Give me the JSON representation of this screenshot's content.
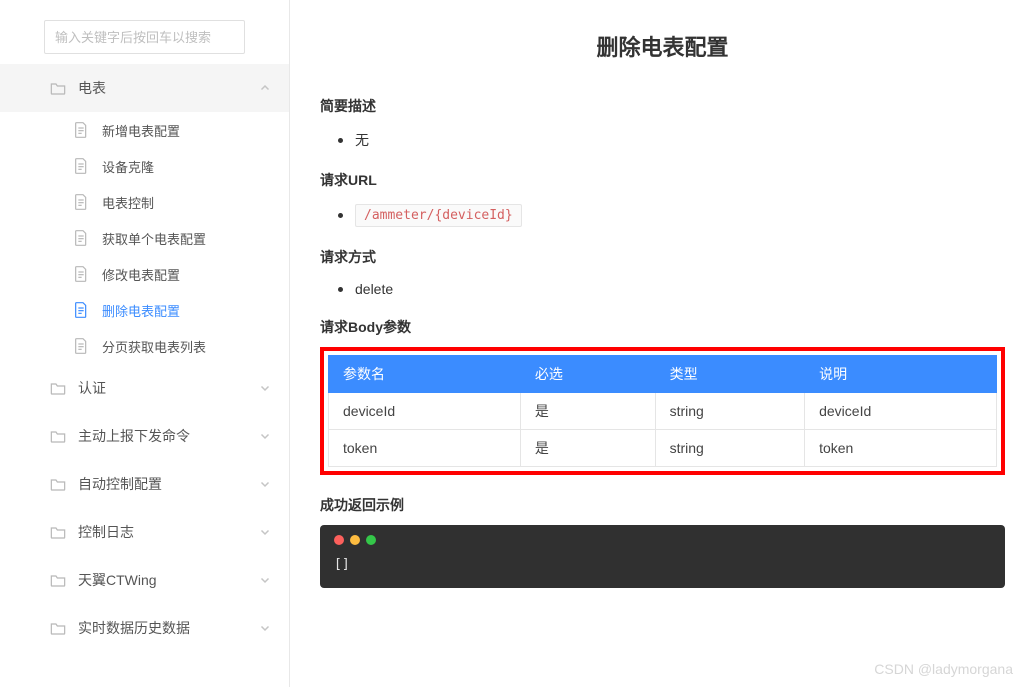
{
  "search": {
    "placeholder": "输入关键字后按回车以搜索"
  },
  "sidebar": {
    "groups": [
      {
        "label": "电表",
        "expanded": true,
        "items": [
          {
            "label": "新增电表配置",
            "active": false
          },
          {
            "label": "设备克隆",
            "active": false
          },
          {
            "label": "电表控制",
            "active": false
          },
          {
            "label": "获取单个电表配置",
            "active": false
          },
          {
            "label": "修改电表配置",
            "active": false
          },
          {
            "label": "删除电表配置",
            "active": true
          },
          {
            "label": "分页获取电表列表",
            "active": false
          }
        ]
      },
      {
        "label": "认证",
        "expanded": false,
        "items": []
      },
      {
        "label": "主动上报下发命令",
        "expanded": false,
        "items": []
      },
      {
        "label": "自动控制配置",
        "expanded": false,
        "items": []
      },
      {
        "label": "控制日志",
        "expanded": false,
        "items": []
      },
      {
        "label": "天翼CTWing",
        "expanded": false,
        "items": []
      },
      {
        "label": "实时数据历史数据",
        "expanded": false,
        "items": []
      }
    ]
  },
  "page": {
    "title": "删除电表配置",
    "sections": {
      "brief": {
        "title": "简要描述",
        "value": "无"
      },
      "url": {
        "title": "请求URL",
        "value": "/ammeter/{deviceId}"
      },
      "method": {
        "title": "请求方式",
        "value": "delete"
      },
      "body_params": {
        "title": "请求Body参数",
        "headers": [
          "参数名",
          "必选",
          "类型",
          "说明"
        ],
        "rows": [
          [
            "deviceId",
            "是",
            "string",
            "deviceId"
          ],
          [
            "token",
            "是",
            "string",
            "token"
          ]
        ]
      },
      "success": {
        "title": "成功返回示例",
        "code": "[]"
      }
    }
  },
  "watermark": "CSDN @ladymorgana"
}
